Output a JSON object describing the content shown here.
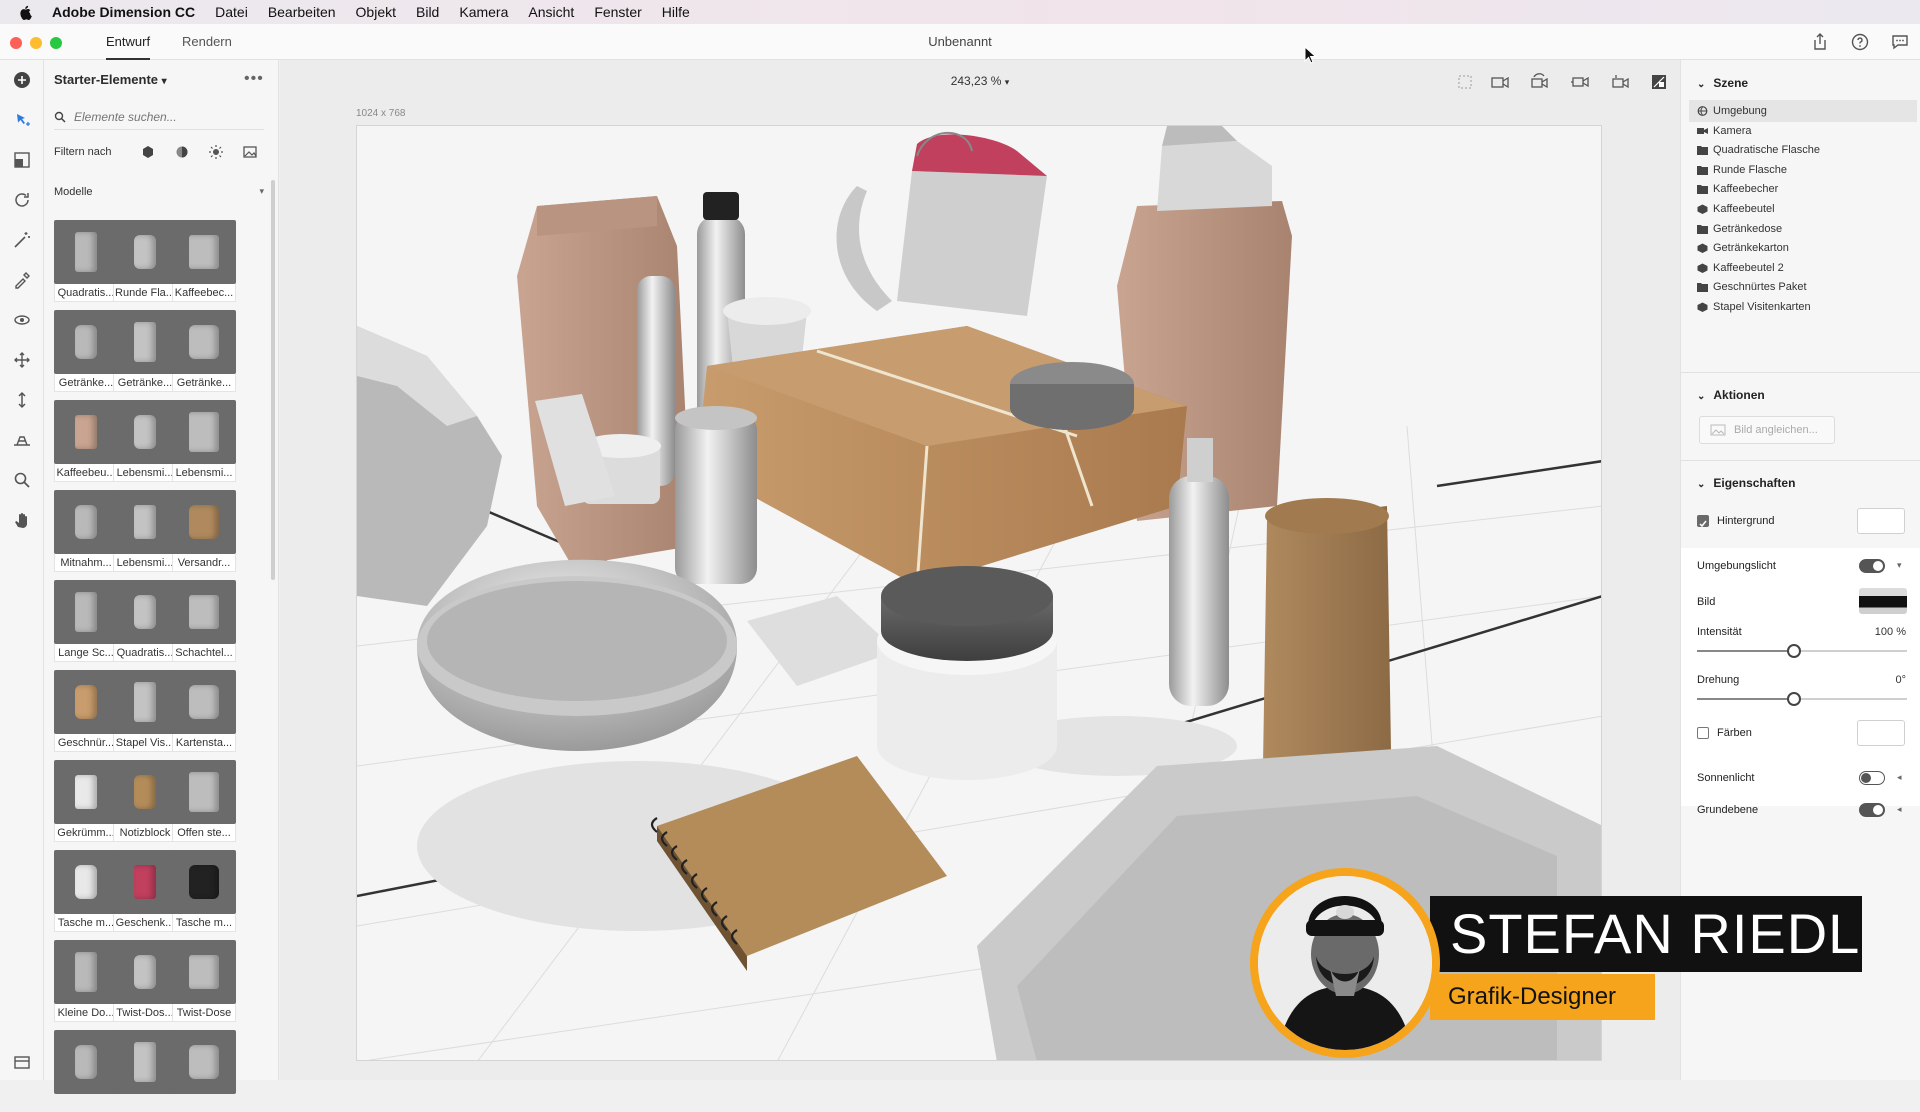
{
  "menubar": {
    "app": "Adobe Dimension CC",
    "items": [
      "Datei",
      "Bearbeiten",
      "Objekt",
      "Bild",
      "Kamera",
      "Ansicht",
      "Fenster",
      "Hilfe"
    ]
  },
  "appbar": {
    "tabs": [
      {
        "label": "Entwurf",
        "active": true
      },
      {
        "label": "Rendern",
        "active": false
      }
    ],
    "document_title": "Unbenannt",
    "icons": [
      "share-icon",
      "help-icon",
      "feedback-icon"
    ]
  },
  "toolbar": {
    "tools": [
      "add-icon",
      "select-icon",
      "scale-icon",
      "rotate-icon",
      "magic-wand-icon",
      "sampler-icon",
      "orbit-icon",
      "pan-camera-icon",
      "dolly-icon",
      "horizon-icon",
      "zoom-icon",
      "hand-icon"
    ]
  },
  "assets": {
    "header": "Starter-Elemente",
    "search_placeholder": "Elemente suchen...",
    "filter_label": "Filtern nach",
    "section": "Modelle",
    "models": [
      "Quadratis...",
      "Runde Fla...",
      "Kaffeebec...",
      "Getränke...",
      "Getränke...",
      "Getränke...",
      "Kaffeebeu...",
      "Lebensmi...",
      "Lebensmi...",
      "Mitnahm...",
      "Lebensmi...",
      "Versandr...",
      "Lange Sc...",
      "Quadratis...",
      "Schachtel...",
      "Geschnür...",
      "Stapel Vis...",
      "Kartensta...",
      "Gekrümm...",
      "Notizblock",
      "Offen ste...",
      "Tasche m...",
      "Geschenk...",
      "Tasche m...",
      "Kleine Do...",
      "Twist-Dos...",
      "Twist-Dose",
      "",
      "",
      ""
    ]
  },
  "canvas": {
    "zoom": "243,23 %",
    "dimensions": "1024 x 768"
  },
  "overlay": {
    "name": "STEFAN RIEDL",
    "role": "Grafik-Designer"
  },
  "scene_panel": {
    "header": "Szene",
    "items": [
      {
        "label": "Umgebung",
        "icon": "environment-icon",
        "selected": true
      },
      {
        "label": "Kamera",
        "icon": "camera-icon"
      },
      {
        "label": "Quadratische Flasche",
        "icon": "folder-icon"
      },
      {
        "label": "Runde Flasche",
        "icon": "folder-icon"
      },
      {
        "label": "Kaffeebecher",
        "icon": "folder-icon"
      },
      {
        "label": "Kaffeebeutel",
        "icon": "model-icon"
      },
      {
        "label": "Getränkedose",
        "icon": "folder-icon"
      },
      {
        "label": "Getränkekarton",
        "icon": "model-icon"
      },
      {
        "label": "Kaffeebeutel 2",
        "icon": "model-icon"
      },
      {
        "label": "Geschnürtes Paket",
        "icon": "folder-icon"
      },
      {
        "label": "Stapel Visitenkarten",
        "icon": "model-icon"
      }
    ]
  },
  "actions_panel": {
    "header": "Aktionen",
    "match_image": "Bild angleichen..."
  },
  "properties": {
    "header": "Eigenschaften",
    "background_label": "Hintergrund",
    "background_checked": true,
    "ambient_label": "Umgebungslicht",
    "ambient_on": true,
    "image_label": "Bild",
    "intensity_label": "Intensität",
    "intensity_value": "100 %",
    "intensity_fraction": 0.46,
    "rotation_label": "Drehung",
    "rotation_value": "0°",
    "rotation_fraction": 0.46,
    "tint_label": "Färben",
    "tint_checked": false,
    "sunlight_label": "Sonnenlicht",
    "sunlight_on": false,
    "groundplane_label": "Grundebene",
    "groundplane_on": true
  }
}
